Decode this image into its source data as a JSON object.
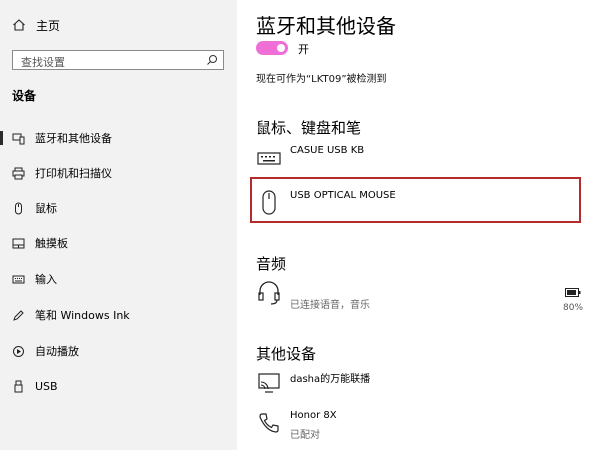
{
  "sidebar": {
    "home_label": "主页",
    "search_placeholder": "查找设置",
    "section_title": "设备",
    "items": [
      {
        "label": "蓝牙和其他设备",
        "icon": "bluetooth-devices-icon",
        "selected": true
      },
      {
        "label": "打印机和扫描仪",
        "icon": "printer-icon",
        "selected": false
      },
      {
        "label": "鼠标",
        "icon": "mouse-icon",
        "selected": false
      },
      {
        "label": "触摸板",
        "icon": "touchpad-icon",
        "selected": false
      },
      {
        "label": "输入",
        "icon": "keyboard-icon",
        "selected": false
      },
      {
        "label": "笔和 Windows Ink",
        "icon": "pen-icon",
        "selected": false
      },
      {
        "label": "自动播放",
        "icon": "autoplay-icon",
        "selected": false
      },
      {
        "label": "USB",
        "icon": "usb-icon",
        "selected": false
      }
    ]
  },
  "main": {
    "title": "蓝牙和其他设备",
    "bluetooth_toggle": {
      "state_label": "开",
      "on": true
    },
    "discoverable_text": "现在可作为“LKT09”被检测到",
    "sections": {
      "input": {
        "title": "鼠标、键盘和笔",
        "devices": [
          {
            "name": "CASUE USB KB",
            "icon": "keyboard-icon"
          },
          {
            "name": "USB OPTICAL MOUSE",
            "icon": "mouse-icon",
            "highlighted": true
          }
        ]
      },
      "audio": {
        "title": "音频",
        "devices": [
          {
            "name": "",
            "status": "已连接语音，音乐",
            "icon": "headset-icon",
            "battery": "80%"
          }
        ]
      },
      "other": {
        "title": "其他设备",
        "devices": [
          {
            "name": "dasha的万能联播",
            "icon": "media-device-icon"
          },
          {
            "name": "Honor 8X",
            "status": "已配对",
            "icon": "phone-icon"
          }
        ]
      }
    }
  },
  "colors": {
    "accent": "#f06fd6",
    "highlight_border": "#b52a2a",
    "sidebar_bg": "#f2f2f2"
  }
}
